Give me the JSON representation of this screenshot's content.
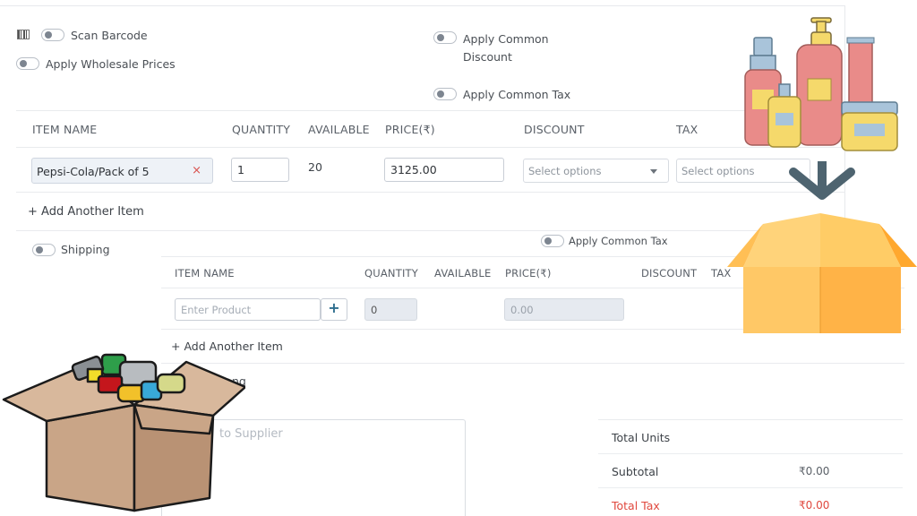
{
  "top": {
    "scan_barcode": "Scan Barcode",
    "wholesale": "Apply Wholesale Prices",
    "common_discount_line1": "Apply Common",
    "common_discount_line2": "Discount",
    "common_tax": "Apply Common Tax",
    "headers": [
      "ITEM NAME",
      "QUANTITY",
      "AVAILABLE",
      "PRICE(₹)",
      "DISCOUNT",
      "TAX"
    ],
    "row": {
      "item": "Pepsi-Cola/Pack of 5",
      "remove": "×",
      "quantity": "1",
      "available": "20",
      "price": "3125.00",
      "discount_placeholder": "Select options",
      "tax_placeholder": "Select options"
    },
    "add_item": "+ Add Another Item",
    "shipping": "Shipping"
  },
  "bottom": {
    "common_tax": "Apply Common Tax",
    "headers": [
      "ITEM NAME",
      "QUANTITY",
      "AVAILABLE",
      "PRICE(₹)",
      "DISCOUNT",
      "TAX"
    ],
    "row": {
      "product_placeholder": "Enter Product",
      "add_symbol": "+",
      "quantity": "0",
      "price": "0.00"
    },
    "add_item": "+ Add Another Item",
    "partial_label": "ng",
    "notes_placeholder_partial": "to Supplier"
  },
  "summary": [
    {
      "label": "Total Units",
      "value": ""
    },
    {
      "label": "Subtotal",
      "value": "₹0.00"
    },
    {
      "label": "Total Tax",
      "value": "₹0.00"
    }
  ],
  "colors": {
    "accent": "#2d6e8e",
    "danger": "#e0483e",
    "box_orange": "#ffb347",
    "arrow": "#4e6470"
  },
  "icons": [
    "barcode-icon",
    "close-icon",
    "chevron-down-icon",
    "plus-icon",
    "down-arrow-icon",
    "open-box-icon",
    "cosmetics-icon",
    "junk-box-icon"
  ]
}
